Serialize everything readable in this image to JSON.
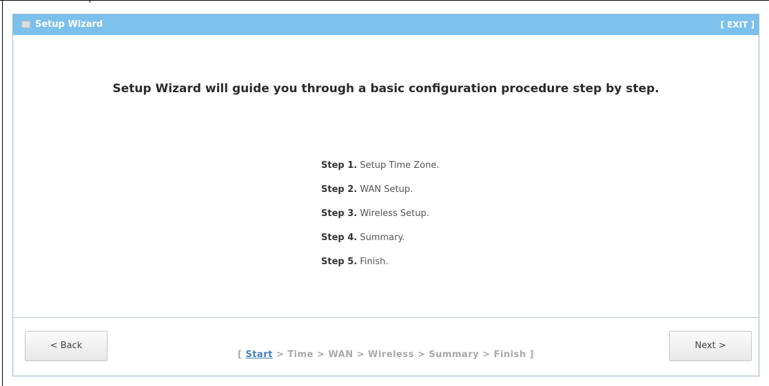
{
  "window": {
    "title": "Setup Wizard",
    "exit_label": "[ EXIT ]"
  },
  "intro_text": "Setup Wizard will guide you through a basic configuration procedure step by step.",
  "steps": [
    {
      "label": "Step 1.",
      "text": " Setup Time Zone."
    },
    {
      "label": "Step 2.",
      "text": " WAN Setup."
    },
    {
      "label": "Step 3.",
      "text": " Wireless Setup."
    },
    {
      "label": "Step 4.",
      "text": " Summary."
    },
    {
      "label": "Step 5.",
      "text": " Finish."
    }
  ],
  "navigation": {
    "back_label": "< Back",
    "next_label": "Next >"
  },
  "progress": {
    "open_bracket": "[ ",
    "current": "Start",
    "rest": " > Time > WAN > Wireless > Summary > Finish ]"
  },
  "colors": {
    "titlebar": "#7cc1ec",
    "current_step": "#3f7fbf",
    "progress_inactive": "#a9a9a9"
  }
}
